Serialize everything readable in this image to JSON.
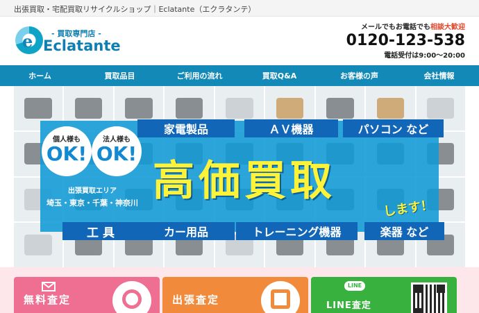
{
  "topbar": {
    "text": "出張買取・宅配買取リサイクルショップ｜Eclatante（エクラタンテ）"
  },
  "logo": {
    "mark": "e",
    "subtitle": "- 買取専門店 -",
    "name": "Eclatante"
  },
  "contact": {
    "lead": "メールでもお電話でも",
    "lead_highlight": "相談大歓迎",
    "phone": "0120-123-538",
    "hours": "電話受付は9:00～20:00"
  },
  "nav": {
    "items": [
      {
        "label": "ホーム"
      },
      {
        "label": "買取品目"
      },
      {
        "label": "ご利用の流れ"
      },
      {
        "label": "買取Q&A"
      },
      {
        "label": "お客様の声"
      },
      {
        "label": "会社情報"
      }
    ]
  },
  "hero": {
    "categories_top": [
      "家電製品",
      "ＡＶ機器",
      "パソコン など"
    ],
    "categories_bottom": [
      "工 具",
      "カー用品",
      "トレーニング機器",
      "楽器 など"
    ],
    "ok_badges": [
      {
        "label": "個人様も",
        "big": "OK!"
      },
      {
        "label": "法人様も",
        "big": "OK!"
      }
    ],
    "area_title": "出張買取エリア",
    "area_list": "埼玉・東京・千葉・神奈川",
    "headline": "高価買取",
    "headline_suffix": "します！",
    "colors": {
      "band": "#109ad6",
      "headline": "#fff33a",
      "category": "#1266b8"
    }
  },
  "cards": [
    {
      "label": "無料査定",
      "icon": "mail-icon",
      "color": "#ef6f93"
    },
    {
      "label": "出張査定",
      "icon": "runner-icon",
      "color": "#f28a3c"
    },
    {
      "label": "LINE査定",
      "badge": "LINE",
      "icon": "qr-code-icon",
      "color": "#39b13f"
    }
  ]
}
